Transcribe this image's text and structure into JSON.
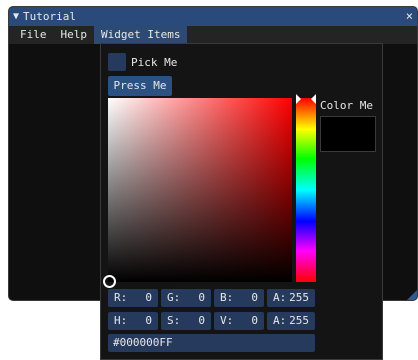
{
  "window": {
    "title": "Tutorial",
    "collapse_glyph": "▼",
    "close_glyph": "×",
    "accent_color": "#294a7a"
  },
  "menubar": {
    "items": [
      {
        "label": "File"
      },
      {
        "label": "Help"
      },
      {
        "label": "Widget Items",
        "active": true
      }
    ]
  },
  "popup": {
    "pick_label": "Pick Me",
    "press_button_label": "Press Me",
    "color_me_label": "Color Me",
    "current_color": "#000000",
    "rgba": {
      "r": {
        "label": "R:",
        "value": "0"
      },
      "g": {
        "label": "G:",
        "value": "0"
      },
      "b": {
        "label": "B:",
        "value": "0"
      },
      "a": {
        "label": "A:",
        "value": "255"
      }
    },
    "hsva": {
      "h": {
        "label": "H:",
        "value": "0"
      },
      "s": {
        "label": "S:",
        "value": "0"
      },
      "v": {
        "label": "V:",
        "value": "0"
      },
      "a": {
        "label": "A:",
        "value": "255"
      }
    },
    "hex_value": "#000000FF"
  }
}
